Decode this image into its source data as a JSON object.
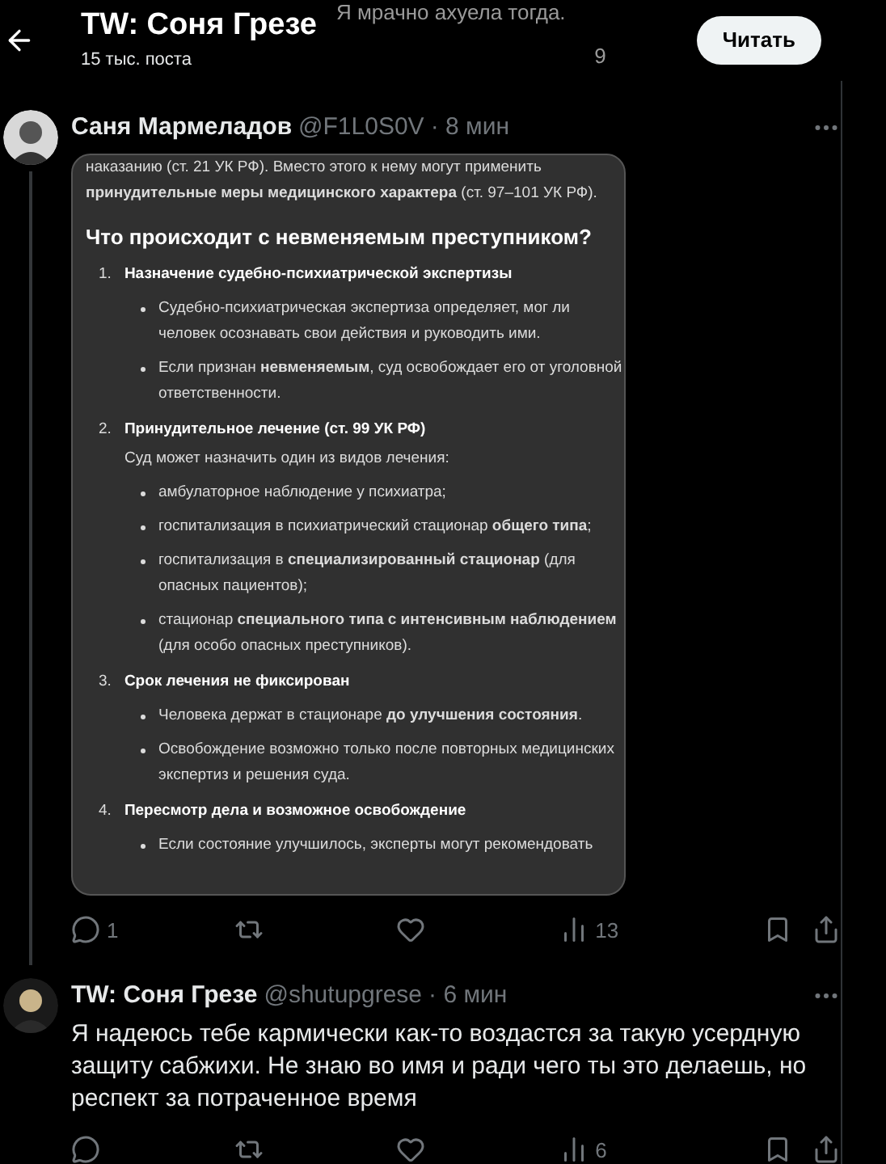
{
  "previous_tweet": {
    "text": "Я мрачно ахуела тогда.",
    "views": "9"
  },
  "header": {
    "title": "TW: Соня Грезе",
    "post_count": "15 тыс. поста",
    "follow_button": "Читать"
  },
  "tweets": [
    {
      "name": "Саня Мармеладов",
      "handle": "@F1L0S0V",
      "time": "· 8 мин",
      "thread_line": true,
      "attachment": {
        "kind": "document",
        "blocks": [
          {
            "kind": "paragraph",
            "text": "наказанию (ст. 21 УК РФ). Вместо этого к нему могут применить **принудительные меры медицинского характера** (ст. 97–101 УК РФ)."
          },
          {
            "kind": "heading",
            "text": "Что происходит с невменяемым преступником?"
          },
          {
            "kind": "numbered",
            "number": "1.",
            "text": "Назначение судебно-психиатрической экспертизы"
          },
          {
            "kind": "bullet",
            "text": "Судебно-психиатрическая экспертиза определяет, мог ли человек осознавать свои действия и руководить ими."
          },
          {
            "kind": "bullet",
            "text": "Если признан **невменяемым**, суд освобождает его от уголовной ответственности."
          },
          {
            "kind": "numbered",
            "number": "2.",
            "text": "Принудительное лечение (ст. 99 УК РФ)"
          },
          {
            "kind": "plain",
            "text": "Суд может назначить один из видов лечения:"
          },
          {
            "kind": "bullet",
            "text": "амбулаторное наблюдение у психиатра;"
          },
          {
            "kind": "bullet",
            "text": "госпитализация в психиатрический стационар **общего типа**;"
          },
          {
            "kind": "bullet",
            "text": "госпитализация в **специализированный стационар** (для опасных пациентов);"
          },
          {
            "kind": "bullet",
            "text": "стационар **специального типа с интенсивным наблюдением** (для особо опасных преступников)."
          },
          {
            "kind": "numbered",
            "number": "3.",
            "text": "Срок лечения не фиксирован"
          },
          {
            "kind": "bullet",
            "text": "Человека держат в стационаре **до улучшения состояния**."
          },
          {
            "kind": "bullet",
            "text": "Освобождение возможно только после повторных медицинских экспертиз и решения суда."
          },
          {
            "kind": "numbered",
            "number": "4.",
            "text": "Пересмотр дела и возможное освобождение"
          },
          {
            "kind": "bullet",
            "text": "Если состояние улучшилось, эксперты могут рекомендовать"
          }
        ]
      },
      "replies": "1",
      "views": "13"
    },
    {
      "name": "TW: Соня Грезе",
      "handle": "@shutupgrese",
      "time": "· 6 мин",
      "thread_line": false,
      "text": "Я надеюсь тебе кармически как-то воздастся за такую усердную защиту сабжихи. Не знаю во имя и ради чего ты это делаешь, но респект за потраченное время",
      "views": "6"
    }
  ]
}
